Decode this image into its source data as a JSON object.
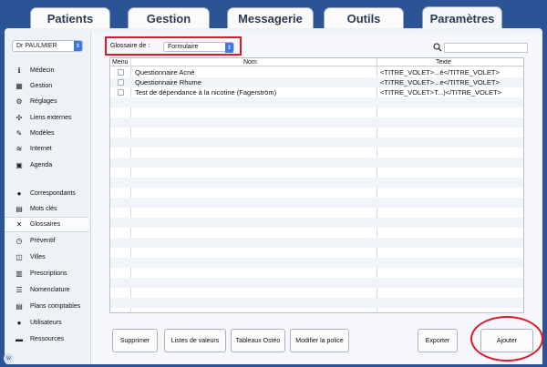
{
  "tabs": [
    "Patients",
    "Gestion",
    "Messagerie",
    "Outils",
    "Paramètres"
  ],
  "sidebar": {
    "doctor": "Dr PAULMIER",
    "items": [
      {
        "label": "Médecin",
        "icon": "info-icon",
        "glyph": "ℹ"
      },
      {
        "label": "Gestion",
        "icon": "calculator-icon",
        "glyph": "▦"
      },
      {
        "label": "Réglages",
        "icon": "gear-icon",
        "glyph": "⚙"
      },
      {
        "label": "Liens externes",
        "icon": "links-icon",
        "glyph": "✣"
      },
      {
        "label": "Modèles",
        "icon": "template-icon",
        "glyph": "✎"
      },
      {
        "label": "Internet",
        "icon": "wifi-icon",
        "glyph": "≋"
      },
      {
        "label": "Agenda",
        "icon": "calendar-icon",
        "glyph": "▣"
      },
      {
        "label": "Correspondants",
        "icon": "person-icon",
        "glyph": "●"
      },
      {
        "label": "Mots clés",
        "icon": "keywords-icon",
        "glyph": "▤"
      },
      {
        "label": "Glossaires",
        "icon": "tools-icon",
        "glyph": "✕"
      },
      {
        "label": "Préventif",
        "icon": "clock-icon",
        "glyph": "◷"
      },
      {
        "label": "Villes",
        "icon": "map-icon",
        "glyph": "◫"
      },
      {
        "label": "Prescriptions",
        "icon": "prescription-icon",
        "glyph": "▥"
      },
      {
        "label": "Nomenclature",
        "icon": "list-icon",
        "glyph": "☰"
      },
      {
        "label": "Plans comptables",
        "icon": "ledger-icon",
        "glyph": "▤"
      },
      {
        "label": "Utilisateurs",
        "icon": "users-icon",
        "glyph": "●"
      },
      {
        "label": "Ressources",
        "icon": "car-icon",
        "glyph": "▬"
      }
    ]
  },
  "glossary": {
    "label": "Glossaire de :",
    "type": "Formulaire"
  },
  "table": {
    "headers": [
      "Menu",
      "Nom",
      "Texte"
    ],
    "rows": [
      {
        "nom": "Questionnaire Acné",
        "texte": "<TITRE_VOLET>...é</TITRE_VOLET>"
      },
      {
        "nom": "Questionnaire Rhume",
        "texte": "<TITRE_VOLET>...e</TITRE_VOLET>"
      },
      {
        "nom": "Test de dépendance à la nicotine (Fagerström)",
        "texte": "<TITRE_VOLET>T...)</TITRE_VOLET>"
      }
    ]
  },
  "buttons": {
    "supprimer": "Supprimer",
    "listes": "Listes de valeurs",
    "tableaux": "Tableaux Ostéo",
    "police": "Modifier la police",
    "exporter": "Exporter",
    "ajouter": "Ajouter"
  },
  "badge": "W",
  "colors": {
    "background": "#2a5494",
    "highlight": "#e0192a",
    "select_accent": "#3b79e0"
  }
}
